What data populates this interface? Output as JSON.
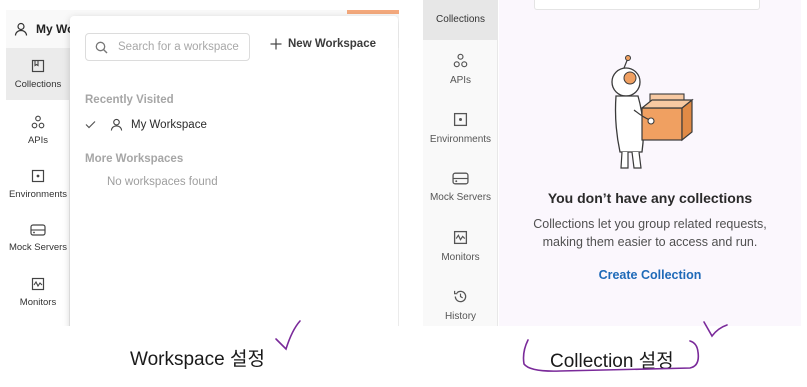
{
  "left": {
    "workspace_switcher_label": "My Workspace",
    "sidebar": [
      {
        "label": "Collections",
        "icon": "collections-icon"
      },
      {
        "label": "APIs",
        "icon": "apis-icon"
      },
      {
        "label": "Environments",
        "icon": "environments-icon"
      },
      {
        "label": "Mock Servers",
        "icon": "mock-servers-icon"
      },
      {
        "label": "Monitors",
        "icon": "monitors-icon"
      }
    ],
    "dropdown": {
      "search_placeholder": "Search for a workspace",
      "new_workspace_label": "New Workspace",
      "recently_visited_heading": "Recently Visited",
      "recent_items": [
        "My Workspace"
      ],
      "more_workspaces_heading": "More Workspaces",
      "empty_message": "No workspaces found"
    }
  },
  "right": {
    "sidebar": [
      {
        "label": "Collections",
        "icon": "collections-icon"
      },
      {
        "label": "APIs",
        "icon": "apis-icon"
      },
      {
        "label": "Environments",
        "icon": "environments-icon"
      },
      {
        "label": "Mock Servers",
        "icon": "mock-servers-icon"
      },
      {
        "label": "Monitors",
        "icon": "monitors-icon"
      },
      {
        "label": "History",
        "icon": "history-icon"
      }
    ],
    "empty_state": {
      "title": "You don’t have any collections",
      "description": "Collections let you group related requests, making them easier to access and run.",
      "action_label": "Create Collection"
    }
  },
  "annotations": {
    "left_caption": "Workspace 설정",
    "right_caption": "Collection 설정"
  },
  "colors": {
    "accent_link": "#1f6ab8",
    "illustration_orange": "#f0a061",
    "annotation_ink": "#7a2a9a",
    "top_strip": "#f4a97d"
  }
}
